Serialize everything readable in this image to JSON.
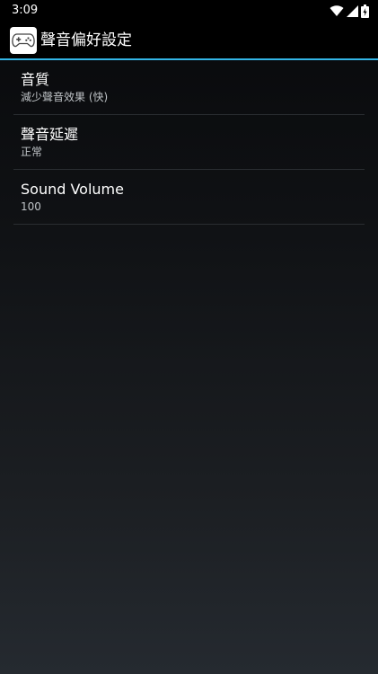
{
  "status_bar": {
    "time": "3:09",
    "icons": [
      "wifi-icon",
      "signal-icon",
      "battery-charging-icon"
    ]
  },
  "action_bar": {
    "app_icon": "gamepad-icon",
    "title": "聲音偏好設定"
  },
  "preferences": [
    {
      "title": "音質",
      "summary": "減少聲音效果 (快)"
    },
    {
      "title": "聲音延遲",
      "summary": "正常"
    },
    {
      "title": "Sound Volume",
      "summary": "100"
    }
  ],
  "colors": {
    "accent": "#33b5e5",
    "summary_text": "#bfc3c7",
    "bar_background": "#000000"
  }
}
